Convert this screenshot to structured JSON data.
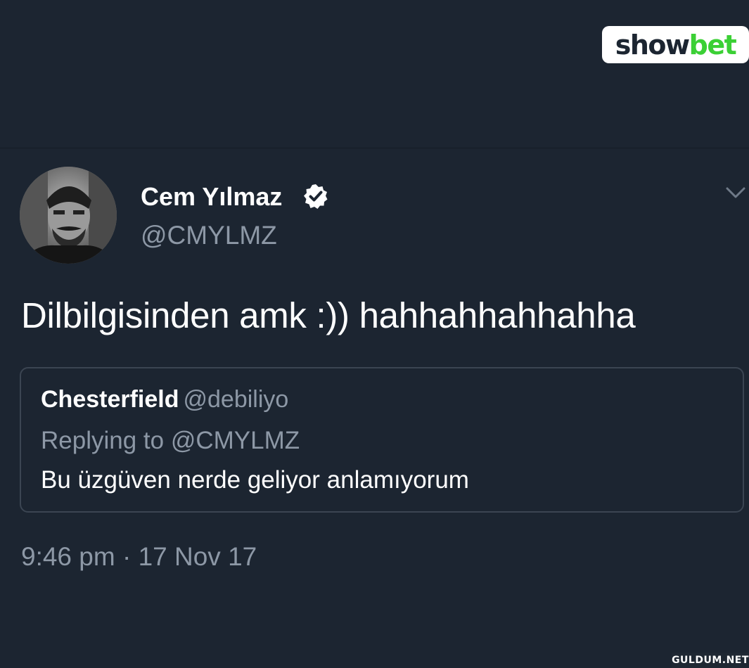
{
  "brand": {
    "logo_part1": "show",
    "logo_part2": "bet",
    "accent_color": "#3bd035"
  },
  "tweet": {
    "author_name": "Cem Yılmaz",
    "author_handle": "@CMYLMZ",
    "verified": true,
    "text": "Dilbilgisinden amk :)) hahhahhahhahha",
    "timestamp": "9:46 pm · 17 Nov 17",
    "avatar_icon": "profile-photo",
    "menu_icon": "chevron-down-icon"
  },
  "quoted_tweet": {
    "author_name": "Chesterfield",
    "author_handle": "@debiliyo",
    "replying_to": "Replying to @CMYLMZ",
    "text": "Bu üzgüven nerde geliyor anlamıyorum"
  },
  "watermark": {
    "text": "GULDUM.NET"
  },
  "colors": {
    "background": "#1c2531",
    "secondary_text": "#8d98a6",
    "primary_text": "#ffffff",
    "card_border": "#3b4552"
  }
}
